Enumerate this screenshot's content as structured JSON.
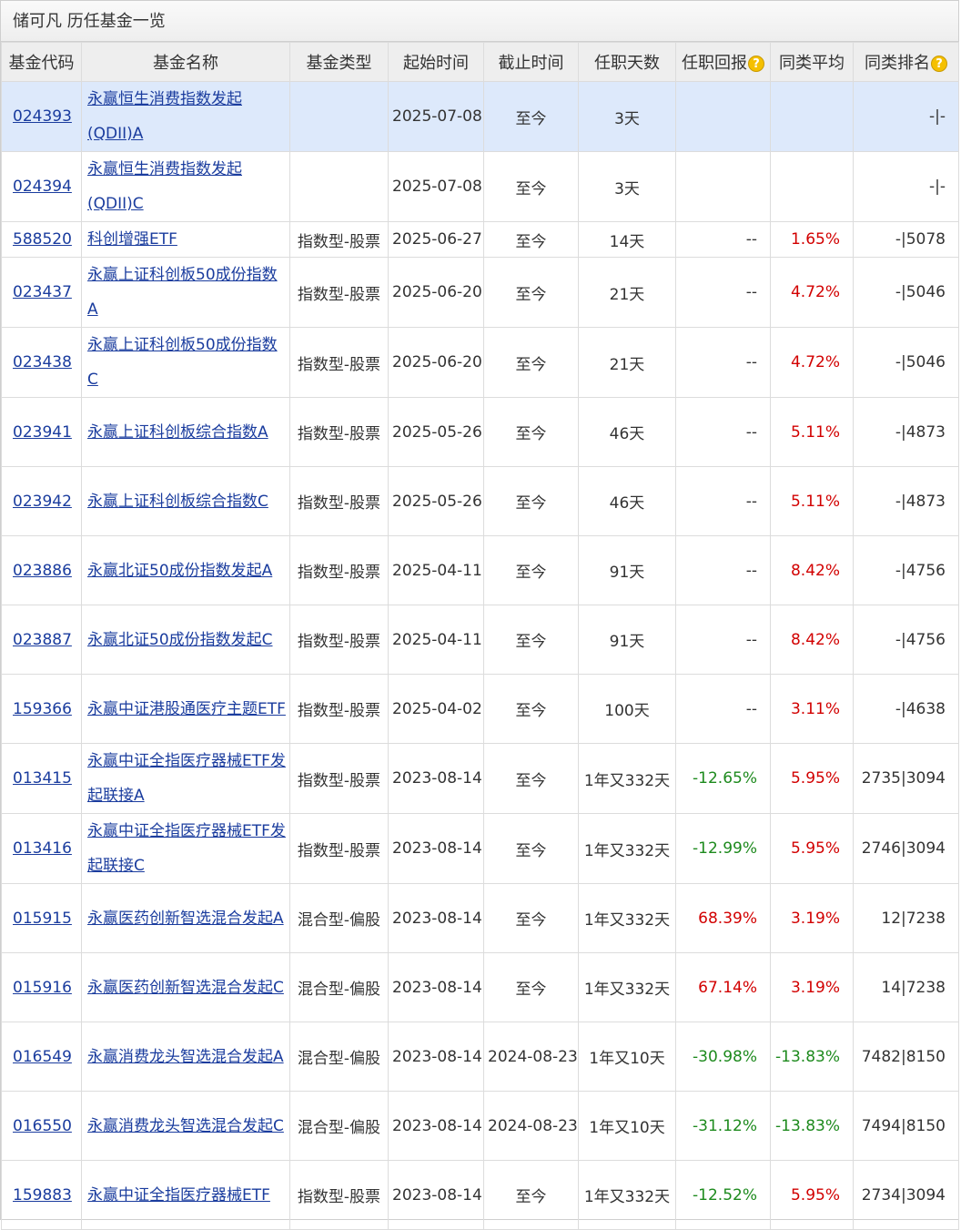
{
  "title": "储可凡 历任基金一览",
  "headers": {
    "code": "基金代码",
    "name": "基金名称",
    "type": "基金类型",
    "start": "起始时间",
    "end": "截止时间",
    "days": "任职天数",
    "ret": "任职回报",
    "avg": "同类平均",
    "rank": "同类排名"
  },
  "icons": {
    "help": "question-mark-icon"
  },
  "colors": {
    "positive": "#d20000",
    "negative": "#1d8a1d",
    "link": "#1a3c9e",
    "highlight": "#dde9fb"
  },
  "rows": [
    {
      "code": "024393",
      "name": "永赢恒生消费指数发起(QDII)A",
      "type": "",
      "start": "2025-07-08",
      "end": "至今",
      "days": "3天",
      "ret": "",
      "avg": "",
      "rank": "-|-",
      "ret_sign": "",
      "avg_sign": ""
    },
    {
      "code": "024394",
      "name": "永赢恒生消费指数发起(QDII)C",
      "type": "",
      "start": "2025-07-08",
      "end": "至今",
      "days": "3天",
      "ret": "",
      "avg": "",
      "rank": "-|-",
      "ret_sign": "",
      "avg_sign": ""
    },
    {
      "code": "588520",
      "name": "科创增强ETF",
      "type": "指数型-股票",
      "start": "2025-06-27",
      "end": "至今",
      "days": "14天",
      "ret": "--",
      "avg": "1.65%",
      "rank": "-|5078",
      "ret_sign": "",
      "avg_sign": "pos"
    },
    {
      "code": "023437",
      "name": "永赢上证科创板50成份指数A",
      "type": "指数型-股票",
      "start": "2025-06-20",
      "end": "至今",
      "days": "21天",
      "ret": "--",
      "avg": "4.72%",
      "rank": "-|5046",
      "ret_sign": "",
      "avg_sign": "pos"
    },
    {
      "code": "023438",
      "name": "永赢上证科创板50成份指数C",
      "type": "指数型-股票",
      "start": "2025-06-20",
      "end": "至今",
      "days": "21天",
      "ret": "--",
      "avg": "4.72%",
      "rank": "-|5046",
      "ret_sign": "",
      "avg_sign": "pos"
    },
    {
      "code": "023941",
      "name": "永赢上证科创板综合指数A",
      "type": "指数型-股票",
      "start": "2025-05-26",
      "end": "至今",
      "days": "46天",
      "ret": "--",
      "avg": "5.11%",
      "rank": "-|4873",
      "ret_sign": "",
      "avg_sign": "pos"
    },
    {
      "code": "023942",
      "name": "永赢上证科创板综合指数C",
      "type": "指数型-股票",
      "start": "2025-05-26",
      "end": "至今",
      "days": "46天",
      "ret": "--",
      "avg": "5.11%",
      "rank": "-|4873",
      "ret_sign": "",
      "avg_sign": "pos"
    },
    {
      "code": "023886",
      "name": "永赢北证50成份指数发起A",
      "type": "指数型-股票",
      "start": "2025-04-11",
      "end": "至今",
      "days": "91天",
      "ret": "--",
      "avg": "8.42%",
      "rank": "-|4756",
      "ret_sign": "",
      "avg_sign": "pos"
    },
    {
      "code": "023887",
      "name": "永赢北证50成份指数发起C",
      "type": "指数型-股票",
      "start": "2025-04-11",
      "end": "至今",
      "days": "91天",
      "ret": "--",
      "avg": "8.42%",
      "rank": "-|4756",
      "ret_sign": "",
      "avg_sign": "pos"
    },
    {
      "code": "159366",
      "name": "永赢中证港股通医疗主题ETF",
      "type": "指数型-股票",
      "start": "2025-04-02",
      "end": "至今",
      "days": "100天",
      "ret": "--",
      "avg": "3.11%",
      "rank": "-|4638",
      "ret_sign": "",
      "avg_sign": "pos"
    },
    {
      "code": "013415",
      "name": "永赢中证全指医疗器械ETF发起联接A",
      "type": "指数型-股票",
      "start": "2023-08-14",
      "end": "至今",
      "days": "1年又332天",
      "ret": "-12.65%",
      "avg": "5.95%",
      "rank": "2735|3094",
      "ret_sign": "neg",
      "avg_sign": "pos"
    },
    {
      "code": "013416",
      "name": "永赢中证全指医疗器械ETF发起联接C",
      "type": "指数型-股票",
      "start": "2023-08-14",
      "end": "至今",
      "days": "1年又332天",
      "ret": "-12.99%",
      "avg": "5.95%",
      "rank": "2746|3094",
      "ret_sign": "neg",
      "avg_sign": "pos"
    },
    {
      "code": "015915",
      "name": "永赢医药创新智选混合发起A",
      "type": "混合型-偏股",
      "start": "2023-08-14",
      "end": "至今",
      "days": "1年又332天",
      "ret": "68.39%",
      "avg": "3.19%",
      "rank": "12|7238",
      "ret_sign": "pos",
      "avg_sign": "pos"
    },
    {
      "code": "015916",
      "name": "永赢医药创新智选混合发起C",
      "type": "混合型-偏股",
      "start": "2023-08-14",
      "end": "至今",
      "days": "1年又332天",
      "ret": "67.14%",
      "avg": "3.19%",
      "rank": "14|7238",
      "ret_sign": "pos",
      "avg_sign": "pos"
    },
    {
      "code": "016549",
      "name": "永赢消费龙头智选混合发起A",
      "type": "混合型-偏股",
      "start": "2023-08-14",
      "end": "2024-08-23",
      "days": "1年又10天",
      "ret": "-30.98%",
      "avg": "-13.83%",
      "rank": "7482|8150",
      "ret_sign": "neg",
      "avg_sign": "neg"
    },
    {
      "code": "016550",
      "name": "永赢消费龙头智选混合发起C",
      "type": "混合型-偏股",
      "start": "2023-08-14",
      "end": "2024-08-23",
      "days": "1年又10天",
      "ret": "-31.12%",
      "avg": "-13.83%",
      "rank": "7494|8150",
      "ret_sign": "neg",
      "avg_sign": "neg"
    },
    {
      "code": "159883",
      "name": "永赢中证全指医疗器械ETF",
      "type": "指数型-股票",
      "start": "2023-08-14",
      "end": "至今",
      "days": "1年又332天",
      "ret": "-12.52%",
      "avg": "5.95%",
      "rank": "2734|3094",
      "ret_sign": "neg",
      "avg_sign": "pos"
    }
  ]
}
